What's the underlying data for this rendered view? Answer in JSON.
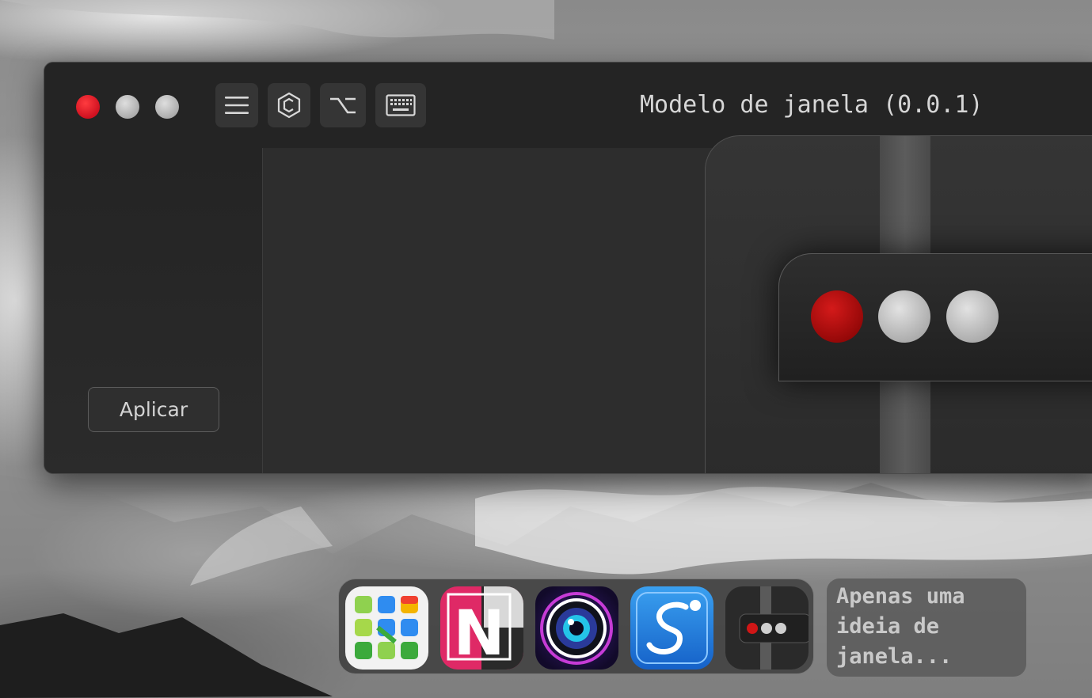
{
  "window": {
    "title": "Modelo de janela (0.0.1)",
    "traffic_lights": {
      "close_color": "#e3202e",
      "minimize_color": "#c4c4c4",
      "maximize_color": "#c4c4c4"
    },
    "toolbar": [
      {
        "icon": "hamburger-menu-icon"
      },
      {
        "icon": "hexagon-icon"
      },
      {
        "icon": "option-key-icon"
      },
      {
        "icon": "keyboard-icon"
      }
    ],
    "sidebar": {
      "apply_label": "Aplicar"
    }
  },
  "preview_icon": {
    "dots": [
      "#c00c0c",
      "#c8c8c8",
      "#c8c8c8"
    ]
  },
  "dock": {
    "apps": [
      {
        "icon": "launchpad-grid-icon"
      },
      {
        "icon": "notes-n-icon"
      },
      {
        "icon": "camera-lens-icon"
      },
      {
        "icon": "sketch-s-icon"
      },
      {
        "icon": "window-template-icon"
      }
    ],
    "tooltip_lines": [
      "Apenas uma",
      "ideia de",
      "janela..."
    ]
  }
}
